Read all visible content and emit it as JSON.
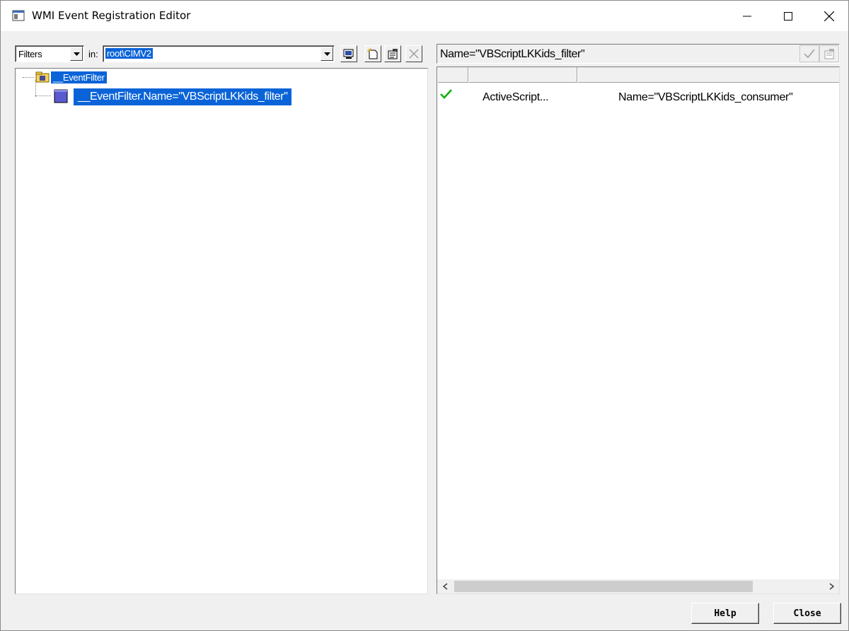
{
  "window": {
    "title": "WMI Event Registration Editor",
    "icon": "window-app-icon"
  },
  "left": {
    "filter_combo_value": "Filters",
    "in_label": "in:",
    "namespace_value": "root\\CIMV2",
    "toolbar_icons": [
      "connect-icon",
      "new-instance-icon",
      "properties-icon",
      "delete-icon"
    ],
    "tree": {
      "class_node": "__EventFilter",
      "instance_node": "__EventFilter.Name=\"VBScriptLKKids_filter\""
    }
  },
  "right": {
    "selected_path": "Name=\"VBScriptLKKids_filter\"",
    "rows": [
      {
        "registered": true,
        "type": "ActiveScript...",
        "instance": "Name=\"VBScriptLKKids_consumer\""
      }
    ]
  },
  "buttons": {
    "help": "Help",
    "close": "Close"
  }
}
